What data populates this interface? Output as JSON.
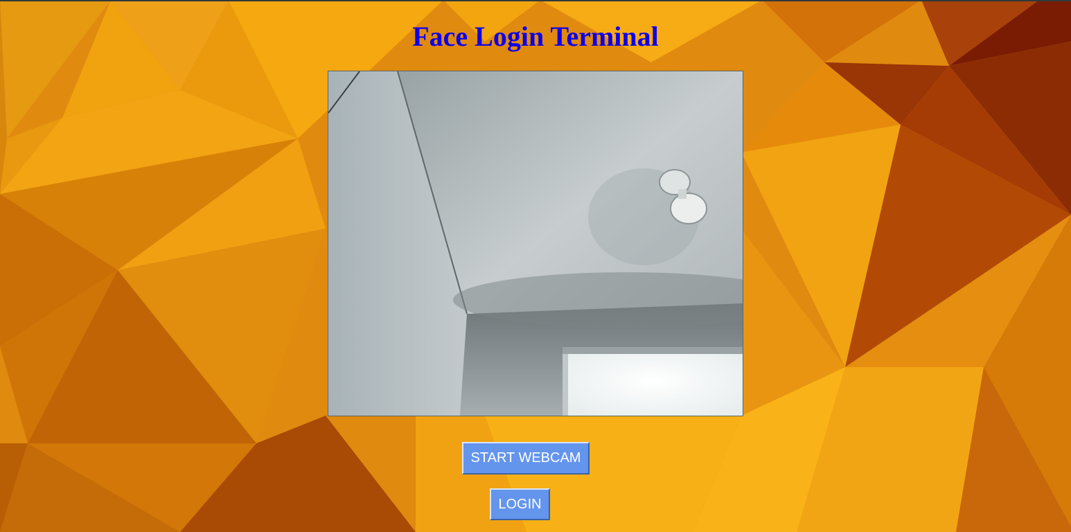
{
  "page": {
    "title": "Face Login Terminal"
  },
  "webcam": {
    "scene": "ceiling-and-wall-with-fan-and-window"
  },
  "buttons": {
    "start_webcam_label": "START WEBCAM",
    "login_label": "LOGIN"
  },
  "colors": {
    "title": "#0f00e8",
    "button_bg": "#6495ed",
    "button_text": "#ffffff",
    "background_orange": "#e08a10",
    "background_dark": "#8a2a00"
  }
}
